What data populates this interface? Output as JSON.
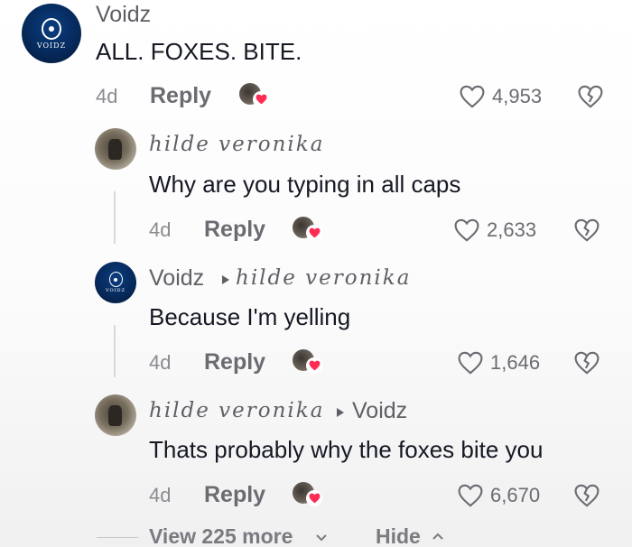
{
  "comments": [
    {
      "author": "Voidz",
      "reply_to": "",
      "text": "ALL. FOXES. BITE.",
      "time": "4d",
      "reply_label": "Reply",
      "likes": "4,953",
      "avatar_label": "VOIDZ"
    },
    {
      "author": "hilde veronika",
      "reply_to": "",
      "text": "Why are you typing in all caps",
      "time": "4d",
      "reply_label": "Reply",
      "likes": "2,633"
    },
    {
      "author": "Voidz",
      "reply_to": "hilde veronika",
      "text": "Because I'm yelling",
      "time": "4d",
      "reply_label": "Reply",
      "likes": "1,646",
      "avatar_label": "VOIDZ"
    },
    {
      "author": "hilde veronika",
      "reply_to": "Voidz",
      "text": "Thats probably why the foxes bite you",
      "time": "4d",
      "reply_label": "Reply",
      "likes": "6,670"
    }
  ],
  "footer": {
    "view_more": "View 225 more",
    "hide": "Hide"
  },
  "colors": {
    "heart_badge": "#fe2c55",
    "voidz_avatar": "#062a5c"
  },
  "icons": [
    "heart-outline-icon",
    "broken-heart-icon",
    "author-liked-icon",
    "chevron-down-icon",
    "chevron-up-icon",
    "triangle-right-icon"
  ]
}
